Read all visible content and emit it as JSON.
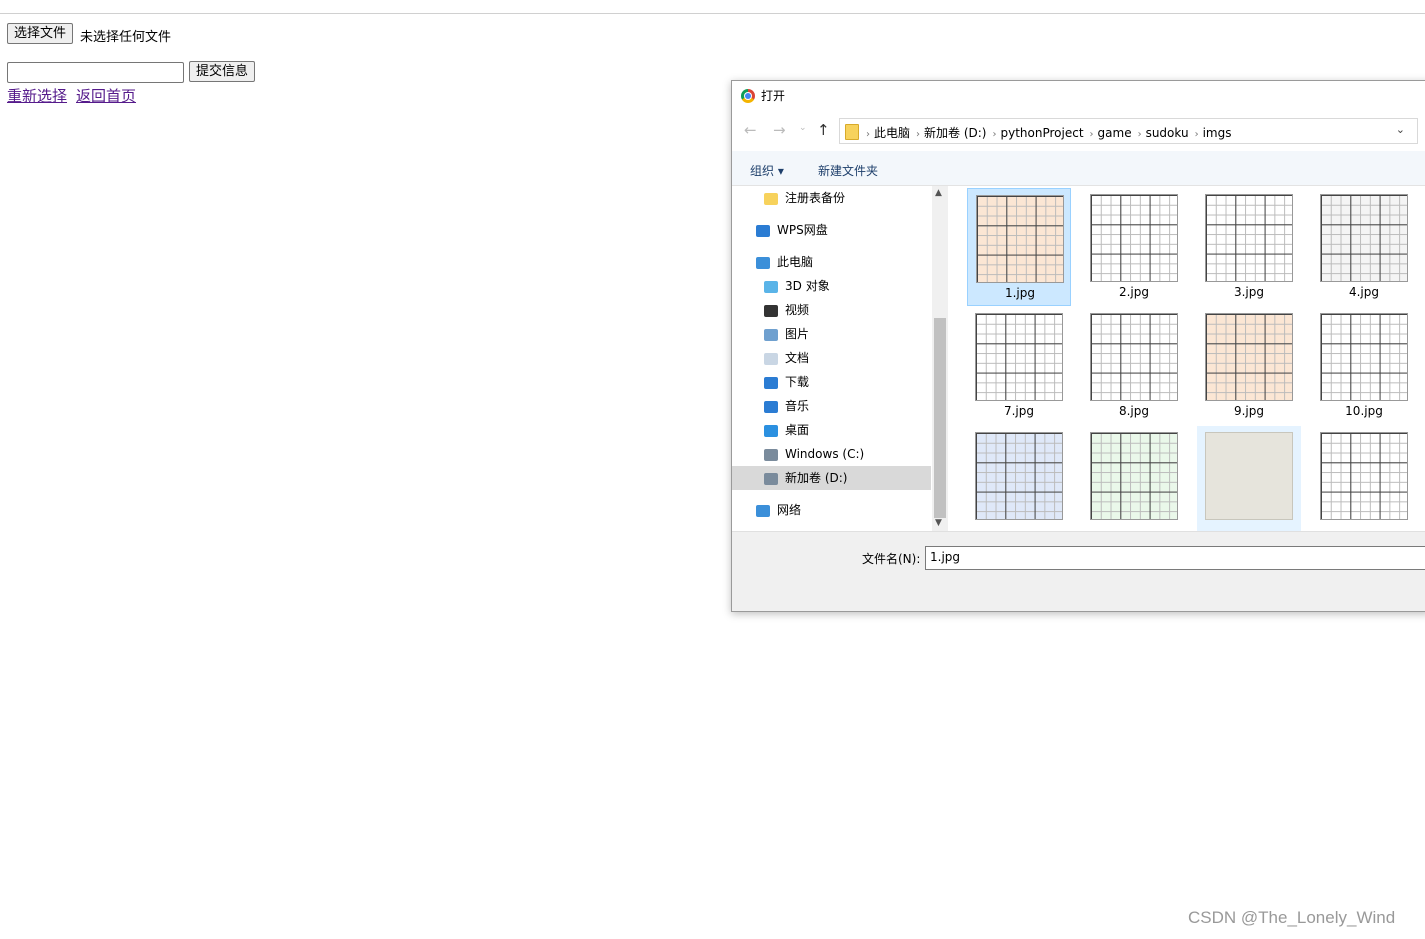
{
  "page": {
    "choose_file_label": "选择文件",
    "no_file_text": "未选择任何文件",
    "text_input_value": "",
    "submit_label": "提交信息",
    "reselect_link": "重新选择",
    "home_link": "返回首页",
    "watermark": "CSDN @The_Lonely_Wind"
  },
  "dialog": {
    "title": "打开",
    "breadcrumbs": [
      "此电脑",
      "新加卷 (D:)",
      "pythonProject",
      "game",
      "sudoku",
      "imgs"
    ],
    "toolbar": {
      "organize": "组织 ▾",
      "new_folder": "新建文件夹"
    },
    "nav_items": [
      {
        "label": "注册表备份",
        "icon": "folder-icon"
      },
      {
        "label": "WPS网盘",
        "icon": "cloud-icon"
      },
      {
        "label": "此电脑",
        "icon": "computer-icon"
      },
      {
        "label": "3D 对象",
        "icon": "cube-icon"
      },
      {
        "label": "视频",
        "icon": "video-icon"
      },
      {
        "label": "图片",
        "icon": "picture-icon"
      },
      {
        "label": "文档",
        "icon": "document-icon"
      },
      {
        "label": "下载",
        "icon": "download-icon"
      },
      {
        "label": "音乐",
        "icon": "music-icon"
      },
      {
        "label": "桌面",
        "icon": "desktop-icon"
      },
      {
        "label": "Windows (C:)",
        "icon": "drive-icon"
      },
      {
        "label": "新加卷 (D:)",
        "icon": "drive-icon"
      },
      {
        "label": "网络",
        "icon": "network-icon"
      }
    ],
    "selected_nav": "新加卷 (D:)",
    "files": [
      {
        "name": "1.jpg",
        "style": "peach",
        "selected": true
      },
      {
        "name": "2.jpg",
        "style": "white"
      },
      {
        "name": "3.jpg",
        "style": "white"
      },
      {
        "name": "4.jpg",
        "style": "grey"
      },
      {
        "name": "7.jpg",
        "style": "white"
      },
      {
        "name": "8.jpg",
        "style": "white"
      },
      {
        "name": "9.jpg",
        "style": "peach"
      },
      {
        "name": "10.jpg",
        "style": "white"
      },
      {
        "name": "",
        "style": "phone"
      },
      {
        "name": "",
        "style": "green"
      },
      {
        "name": "",
        "style": "photo",
        "highlighted": true
      },
      {
        "name": "",
        "style": "white"
      }
    ],
    "filename_label": "文件名(N):",
    "filename_value": "1.jpg"
  }
}
